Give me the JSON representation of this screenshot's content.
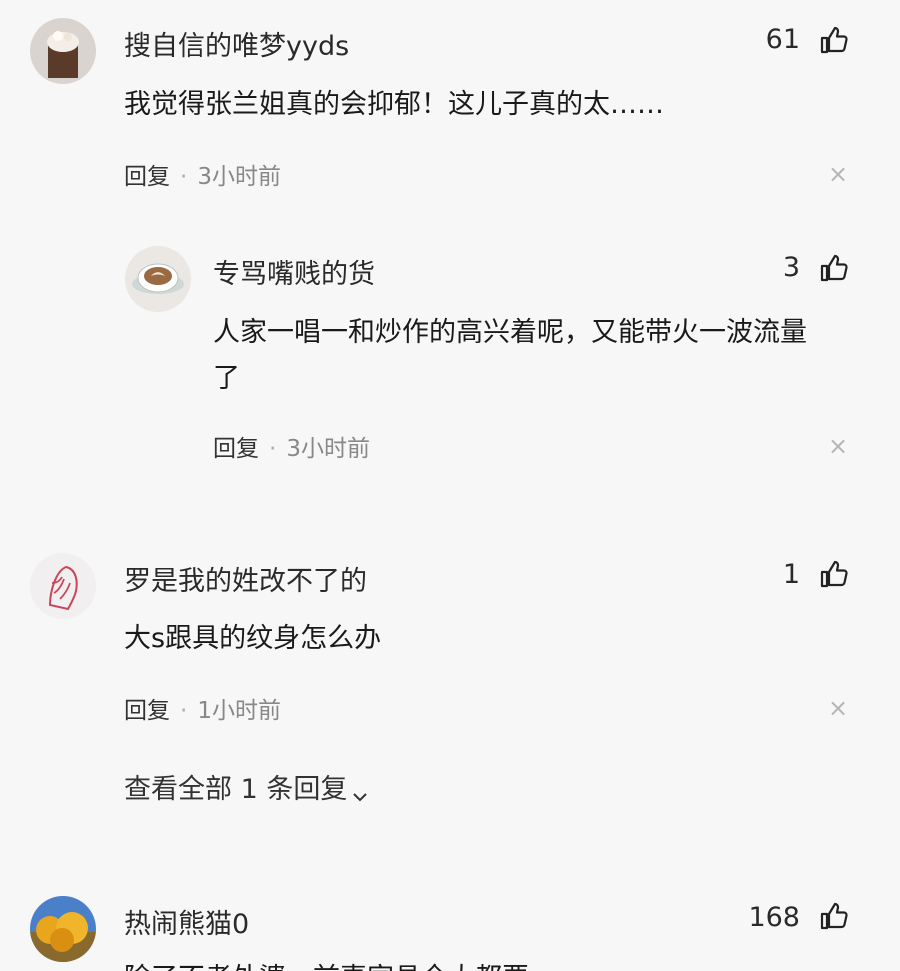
{
  "comments": [
    {
      "username": "搜自信的唯梦yyds",
      "likes": "61",
      "content": "我觉得张兰姐真的会抑郁！这儿子真的太……",
      "reply_label": "回复",
      "time": "3小时前",
      "close": "×"
    },
    {
      "username": "专骂嘴贱的货",
      "likes": "3",
      "content": "人家一唱一和炒作的高兴着呢，又能带火一波流量了",
      "reply_label": "回复",
      "time": "3小时前",
      "close": "×"
    },
    {
      "username": "罗是我的姓改不了的",
      "likes": "1",
      "content": "大s跟具的纹身怎么办",
      "reply_label": "回复",
      "time": "1小时前",
      "close": "×",
      "view_replies": "查看全部 1 条回复"
    },
    {
      "username": "热闹熊猫0",
      "likes": "168",
      "content": "除了不孝外婆，前妻家具全大都要"
    }
  ],
  "icons": {
    "like": "thumbs-up-icon",
    "close": "close-icon",
    "chevron": "chevron-down-icon"
  },
  "colors": {
    "background": "#f7f7f7",
    "text": "#1c1c1c",
    "meta": "#888888"
  }
}
